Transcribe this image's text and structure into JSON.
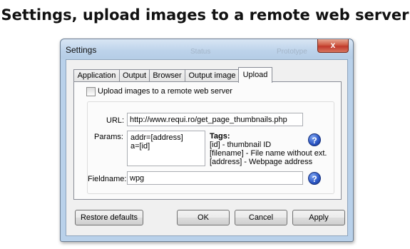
{
  "heading": "Settings, upload images to a remote web server",
  "window": {
    "title": "Settings",
    "ghost_status": "Status",
    "ghost_prototype": "Prototype",
    "close_label": "x"
  },
  "tabs": [
    {
      "label": "Application",
      "active": false
    },
    {
      "label": "Output",
      "active": false
    },
    {
      "label": "Browser",
      "active": false
    },
    {
      "label": "Output image",
      "active": false
    },
    {
      "label": "Upload",
      "active": true
    }
  ],
  "upload": {
    "checkbox_label": "Upload images to a remote web server",
    "checked": false,
    "url_label": "URL:",
    "url_value": "http://www.requi.ro/get_page_thumbnails.php",
    "params_label": "Params:",
    "params_lines": [
      "addr=[address]",
      "a=[id]"
    ],
    "tags_title": "Tags:",
    "tags": [
      "[id] - thumbnail ID",
      "[filename] - File name without ext.",
      "[address] - Webpage address"
    ],
    "fieldname_label": "Fieldname:",
    "fieldname_value": "wpg",
    "help_glyph": "?"
  },
  "buttons": {
    "restore": "Restore defaults",
    "ok": "OK",
    "cancel": "Cancel",
    "apply": "Apply"
  },
  "icons": {
    "close": "close-icon",
    "help": "question-mark-icon"
  }
}
